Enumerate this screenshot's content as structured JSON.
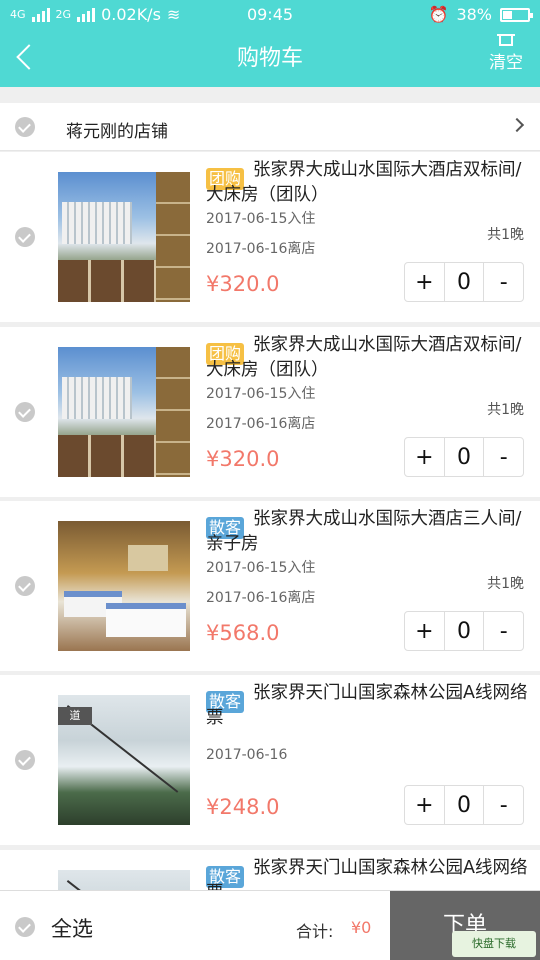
{
  "status": {
    "network_a": "4G",
    "network_b": "2G",
    "speed": "0.02K/s",
    "time": "09:45",
    "battery_pct": "38%",
    "battery_level": 0.38
  },
  "header": {
    "title": "购物车",
    "clear_label": "清空"
  },
  "shop": {
    "name": "蒋元刚的店铺"
  },
  "items": [
    {
      "tag": "团购",
      "title": "张家界大成山水国际大酒店双标间/大床房（团队）",
      "checkin": "2017-06-15入住",
      "checkout": "2017-06-16离店",
      "nights": "共1晚",
      "price": "¥320.0",
      "qty": "0",
      "image": "hotel"
    },
    {
      "tag": "团购",
      "title": "张家界大成山水国际大酒店双标间/大床房（团队）",
      "checkin": "2017-06-15入住",
      "checkout": "2017-06-16离店",
      "nights": "共1晚",
      "price": "¥320.0",
      "qty": "0",
      "image": "hotel"
    },
    {
      "tag": "散客",
      "title": "张家界大成山水国际大酒店三人间/亲子房",
      "checkin": "2017-06-15入住",
      "checkout": "2017-06-16离店",
      "nights": "共1晚",
      "price": "¥568.0",
      "qty": "0",
      "image": "room"
    },
    {
      "tag": "散客",
      "title": "张家界天门山国家森林公园A线网络票",
      "date": "2017-06-16",
      "price": "¥248.0",
      "qty": "0",
      "image": "park",
      "image_label": "道"
    },
    {
      "tag": "散客",
      "title": "张家界天门山国家森林公园A线网络票"
    }
  ],
  "stepper": {
    "plus": "+",
    "minus": "-"
  },
  "bottom": {
    "select_all": "全选",
    "total_label": "合计:",
    "total_value": "¥0",
    "order_label": "下单",
    "watermark": "快盘下载"
  }
}
